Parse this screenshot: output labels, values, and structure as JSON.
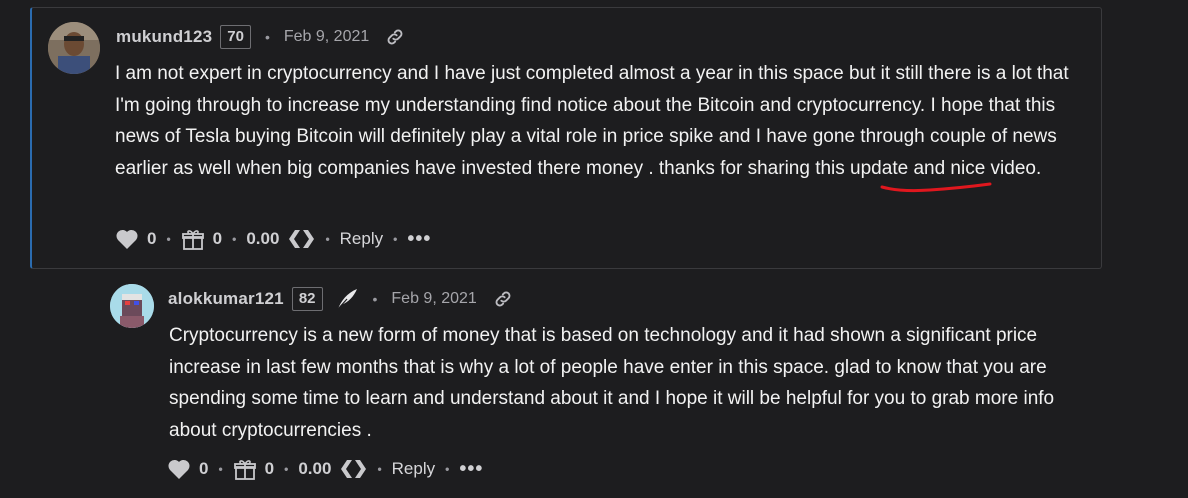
{
  "comments": [
    {
      "username": "mukund123",
      "reputation": "70",
      "date": "Feb 9, 2021",
      "body": "I am not expert in cryptocurrency and I have just completed almost a year in this space but it still there is a lot that I'm going through to increase my understanding find notice about the Bitcoin and cryptocurrency. I hope that this news of Tesla buying Bitcoin will definitely play a vital role in price spike and I have gone through couple of news earlier as well when big companies have invested there money . thanks for sharing this update and nice video.",
      "votes": "0",
      "gifts": "0",
      "payout": "0.00",
      "reply_label": "Reply",
      "more_label": "•••"
    },
    {
      "username": "alokkumar121",
      "reputation": "82",
      "date": "Feb 9, 2021",
      "body": "Cryptocurrency is a new form of money that is based on technology and it had shown a significant price increase in last few months that is why a lot of people have enter in this space. glad to know that you are spending some time to learn and understand about it and I hope it will be helpful for you to grab more info about cryptocurrencies .",
      "votes": "0",
      "gifts": "0",
      "payout": "0.00",
      "reply_label": "Reply",
      "more_label": "•••"
    }
  ],
  "separators": {
    "dot": "•"
  },
  "colors": {
    "accent_border": "#2b6cb0",
    "underline": "#e0171e",
    "background": "#1d1d1f"
  },
  "icons": [
    "heart-icon",
    "gift-icon",
    "hive-icon",
    "link-icon",
    "quill-icon",
    "ellipsis-icon"
  ]
}
